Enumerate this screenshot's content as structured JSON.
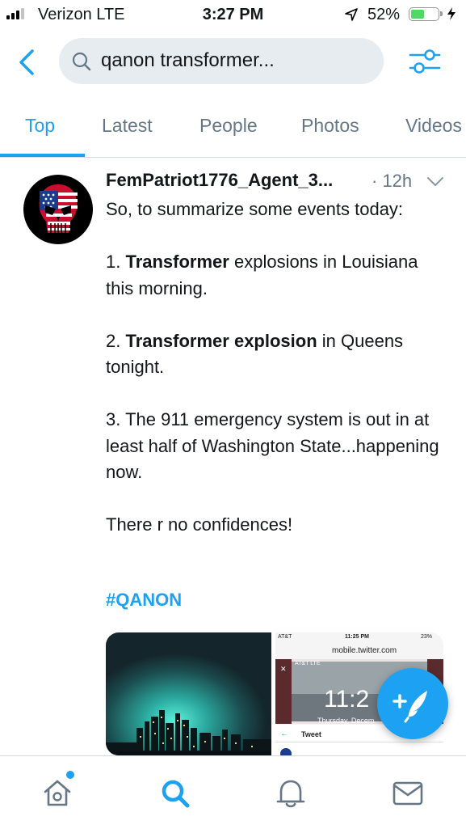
{
  "status_bar": {
    "carrier": "Verizon  LTE",
    "time": "3:27 PM",
    "battery_percent": "52%",
    "battery_level": 0.52
  },
  "search": {
    "query": "qanon transformer..."
  },
  "tabs": [
    {
      "label": "Top",
      "active": true
    },
    {
      "label": "Latest",
      "active": false
    },
    {
      "label": "People",
      "active": false
    },
    {
      "label": "Photos",
      "active": false
    },
    {
      "label": "Videos",
      "active": false
    }
  ],
  "tweet": {
    "username": "FemPatriot1776_Agent_3...",
    "time_ago": "· 12h",
    "hashtag": "#QANON"
  },
  "embedded_screenshot": {
    "status_carrier": "AT&T",
    "status_time": "11:25 PM",
    "status_battery": "23%",
    "url": "mobile.twitter.com",
    "inner_carrier": "AT&T  LTE",
    "lock_time": "11:2",
    "lock_date": "Thursday, Decem",
    "tweet_header": "Tweet"
  },
  "icons": {
    "back": "chevron-left-icon",
    "search": "search-icon",
    "filter": "filter-sliders-icon",
    "compose": "compose-tweet-icon",
    "home": "home-icon",
    "explore": "search-icon",
    "notifications": "bell-icon",
    "messages": "mail-icon"
  },
  "colors": {
    "accent": "#1da1f2",
    "text": "#14171a",
    "muted": "#657786"
  }
}
